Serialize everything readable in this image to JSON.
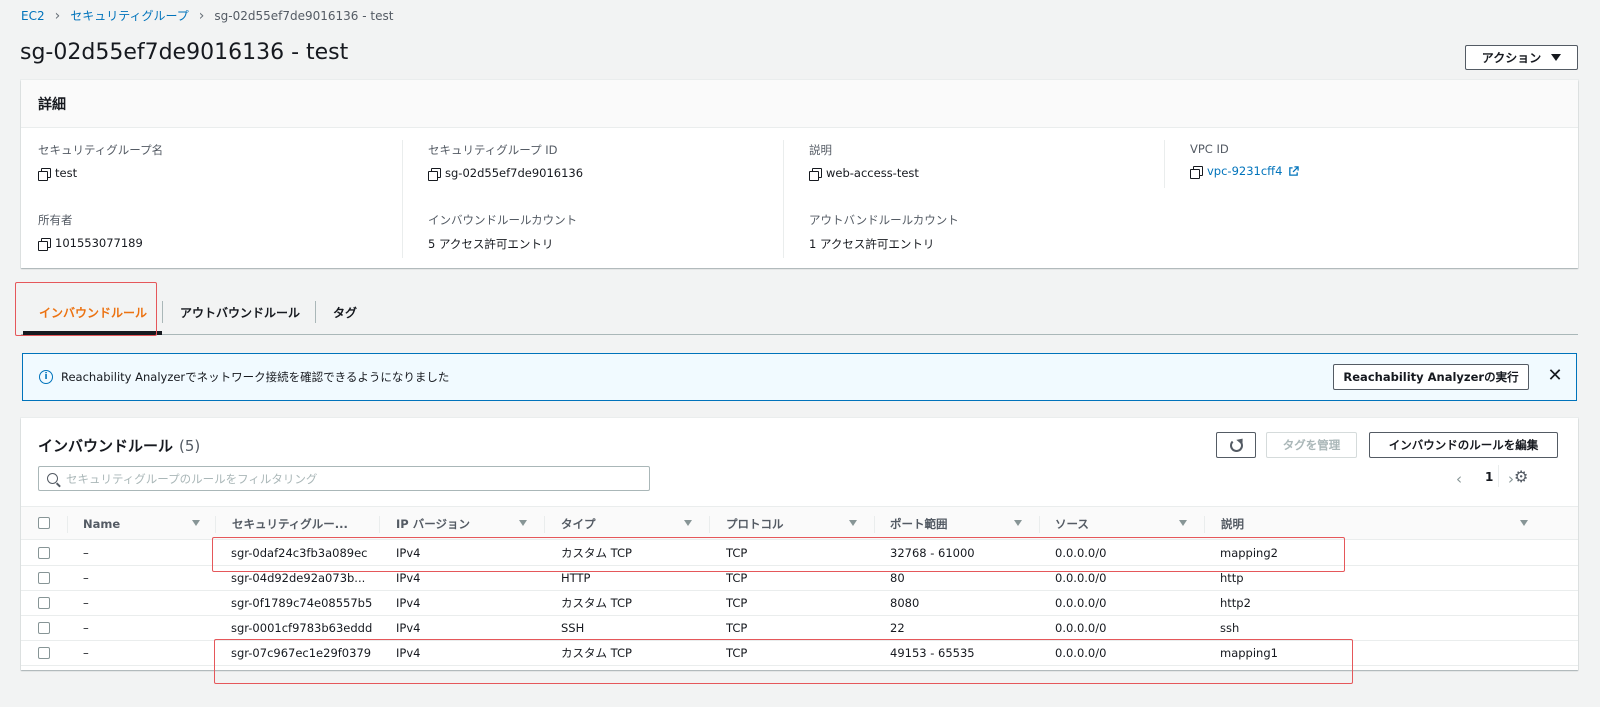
{
  "breadcrumb": [
    "EC2",
    "セキュリティグループ",
    "sg-02d55ef7de9016136 - test"
  ],
  "page_title": "sg-02d55ef7de9016136 - test",
  "actions_label": "アクション",
  "details": {
    "header": "詳細",
    "fields": [
      {
        "label": "セキュリティグループ名",
        "value": "test",
        "copy": true
      },
      {
        "label": "セキュリティグループ ID",
        "value": "sg-02d55ef7de9016136",
        "copy": true
      },
      {
        "label": "説明",
        "value": "web-access-test",
        "copy": true
      },
      {
        "label": "VPC ID",
        "value": "vpc-9231cff4",
        "copy": true,
        "link": true
      },
      {
        "label": "所有者",
        "value": "101553077189",
        "copy": true
      },
      {
        "label": "インバウンドルールカウント",
        "value": "5 アクセス許可エントリ"
      },
      {
        "label": "アウトバンドルールカウント",
        "value": "1 アクセス許可エントリ"
      }
    ]
  },
  "tabs": [
    "インバウンドルール",
    "アウトバウンドルール",
    "タグ"
  ],
  "alert": {
    "text": "Reachability Analyzerでネットワーク接続を確認できるようになりました",
    "button": "Reachability Analyzerの実行",
    "close": "✕"
  },
  "rules": {
    "title": "インバウンドルール",
    "count": "(5)",
    "manage_tags": "タグを管理",
    "edit_rules": "インバウンドのルールを編集",
    "filter_placeholder": "セキュリティグループのルールをフィルタリング",
    "page": "1",
    "columns": [
      "Name",
      "セキュリティグルー...",
      "IP バージョン",
      "タイプ",
      "プロトコル",
      "ポート範囲",
      "ソース",
      "説明"
    ],
    "rows": [
      [
        "–",
        "sgr-0daf24c3fb3a089ec",
        "IPv4",
        "カスタム TCP",
        "TCP",
        "32768 - 61000",
        "0.0.0.0/0",
        "mapping2"
      ],
      [
        "–",
        "sgr-04d92de92a073b...",
        "IPv4",
        "HTTP",
        "TCP",
        "80",
        "0.0.0.0/0",
        "http"
      ],
      [
        "–",
        "sgr-0f1789c74e08557b5",
        "IPv4",
        "カスタム TCP",
        "TCP",
        "8080",
        "0.0.0.0/0",
        "http2"
      ],
      [
        "–",
        "sgr-0001cf9783b63eddd",
        "IPv4",
        "SSH",
        "TCP",
        "22",
        "0.0.0.0/0",
        "ssh"
      ],
      [
        "–",
        "sgr-07c967ec1e29f0379",
        "IPv4",
        "カスタム TCP",
        "TCP",
        "49153 - 65535",
        "0.0.0.0/0",
        "mapping1"
      ]
    ]
  },
  "colors": {
    "accent": "#ec7211",
    "link": "#0073bb",
    "highlight": "#e5575a"
  }
}
